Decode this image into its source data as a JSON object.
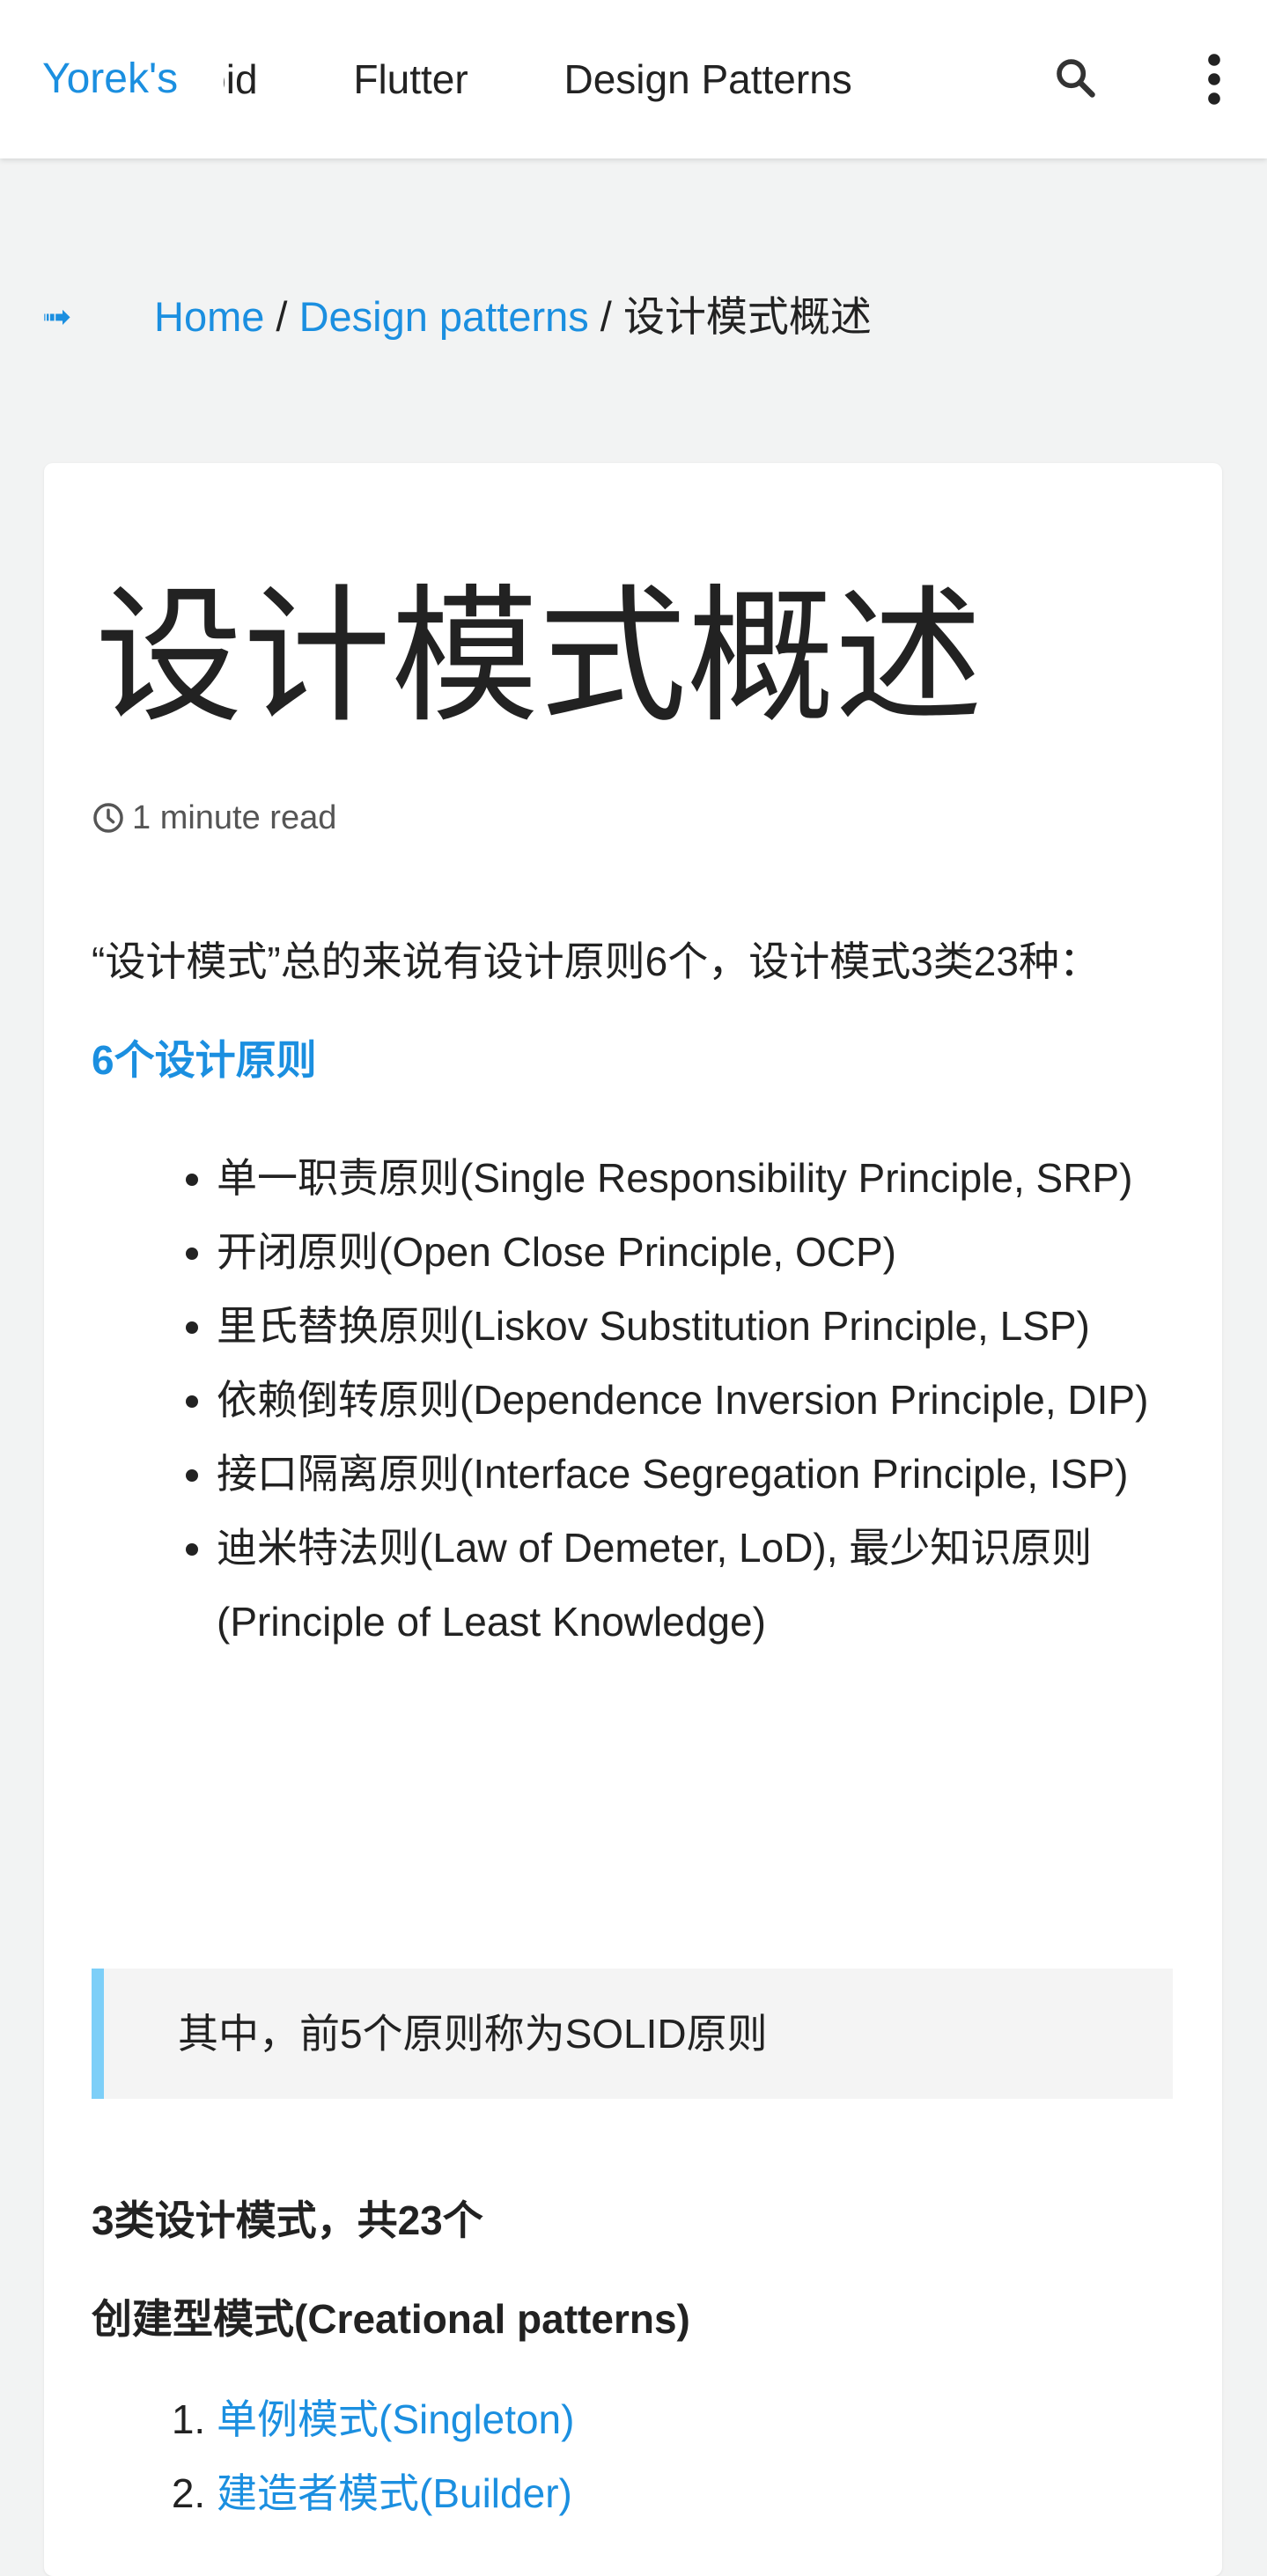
{
  "header": {
    "site_title": "Yorek's",
    "nav_items": [
      "Android",
      "Flutter",
      "Design Patterns"
    ],
    "search_icon": "search-icon",
    "more_icon": "vertical-dots-icon"
  },
  "breadcrumb": {
    "arrow": "➟",
    "home": "Home",
    "separator": " / ",
    "category": "Design patterns",
    "current": "设计模式概述"
  },
  "article": {
    "title": "设计模式概述",
    "read_time": "1 minute read",
    "intro": "“设计模式”总的来说有设计原则6个，设计模式3类23种：",
    "principles_heading": "6个设计原则",
    "principles": [
      "单一职责原则(Single Responsibility Principle, SRP)",
      "开闭原则(Open Close Principle, OCP)",
      "里氏替换原则(Liskov Substitution Principle, LSP)",
      "依赖倒转原则(Dependence Inversion Principle, DIP)",
      "接口隔离原则(Interface Segregation Principle, ISP)",
      "迪米特法则(Law of Demeter, LoD), 最少知识原则(Principle of Least Knowledge)"
    ],
    "callout": "其中，前5个原则称为SOLID原则",
    "patterns_heading": "3类设计模式，共23个",
    "creational_heading": "创建型模式(Creational patterns)",
    "creational_patterns": [
      "单例模式(Singleton)",
      "建造者模式(Builder)"
    ]
  },
  "colors": {
    "accent": "#1b8fe0",
    "callout_border": "#7dcff8",
    "page_bg": "#f2f3f3"
  }
}
